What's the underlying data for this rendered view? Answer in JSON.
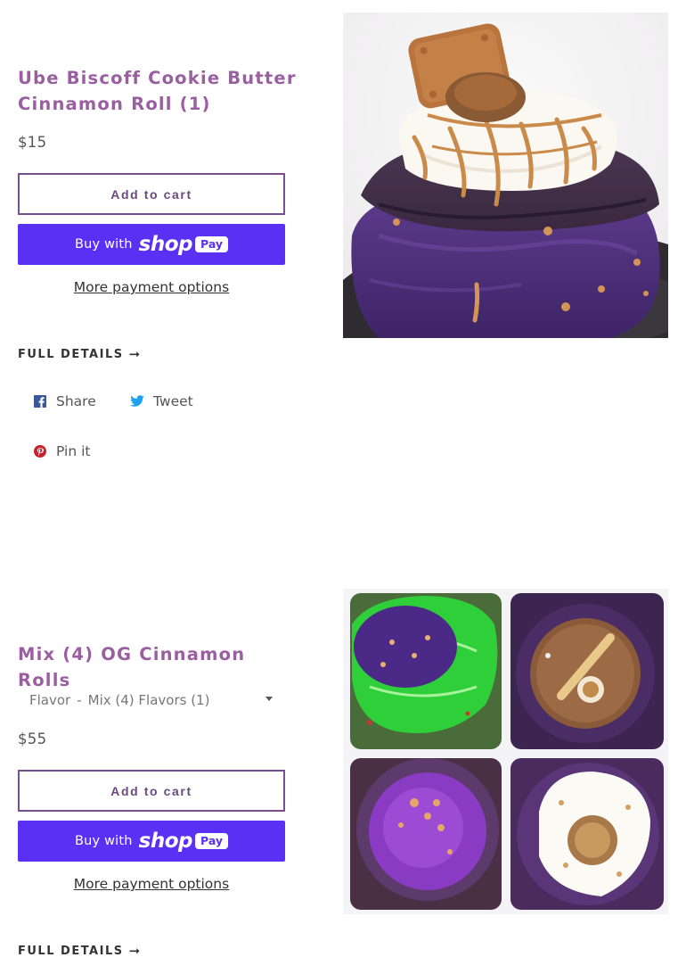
{
  "products": [
    {
      "title": "Ube Biscoff Cookie Butter Cinnamon Roll (1)",
      "price": "$15",
      "add_to_cart": "Add to cart",
      "buy_with": "Buy with",
      "shop_word": "shop",
      "pay_word": "Pay",
      "more_payment": "More payment options",
      "full_details": "FULL DETAILS",
      "share": {
        "facebook": "Share",
        "twitter": "Tweet",
        "pinterest": "Pin it"
      }
    },
    {
      "title": "Mix (4) OG Cinnamon Rolls",
      "variant": {
        "label": "Flavor",
        "separator": "-",
        "value": "Mix (4) Flavors (1)"
      },
      "price": "$55",
      "add_to_cart": "Add to cart",
      "buy_with": "Buy with",
      "shop_word": "shop",
      "pay_word": "Pay",
      "more_payment": "More payment options",
      "full_details": "FULL DETAILS"
    }
  ],
  "colors": {
    "title": "#9a5fa0",
    "shop_pay": "#5a31f4",
    "cart_border": "#7a4f91",
    "facebook": "#3b5998",
    "twitter": "#1da1f2",
    "pinterest": "#c8232c"
  },
  "icons": {
    "facebook": "facebook-icon",
    "twitter": "twitter-icon",
    "pinterest": "pinterest-icon",
    "arrow": "right-arrow-icon",
    "caret": "chevron-down-icon"
  }
}
